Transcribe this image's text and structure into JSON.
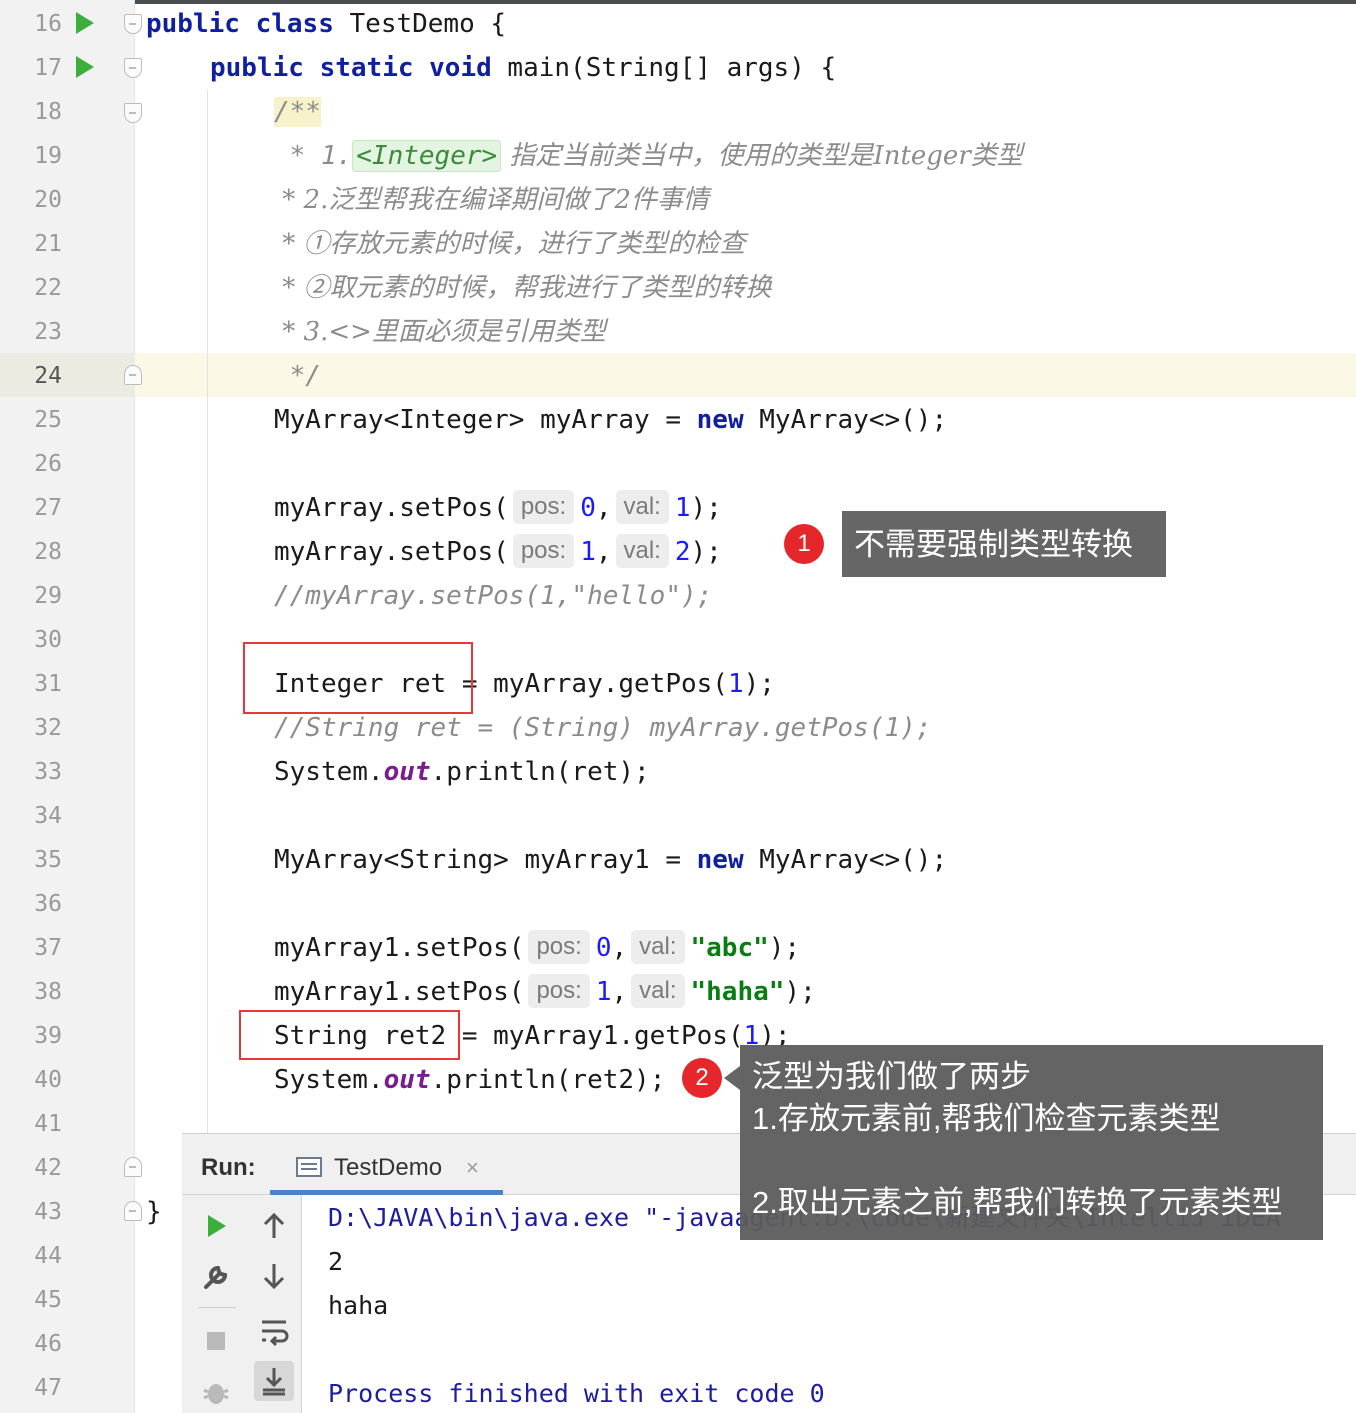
{
  "editor": {
    "line_numbers": [
      "16",
      "17",
      "18",
      "19",
      "20",
      "21",
      "22",
      "23",
      "24",
      "25",
      "26",
      "27",
      "28",
      "29",
      "30",
      "31",
      "32",
      "33",
      "34",
      "35",
      "36",
      "37",
      "38",
      "39",
      "40",
      "41",
      "42",
      "43",
      "44",
      "45",
      "46",
      "47"
    ],
    "current_line": "24",
    "lines": {
      "l16": {
        "kw1": "public",
        "kw2": "class",
        "rest": " TestDemo {"
      },
      "l17": {
        "kw1": "public",
        "kw2": "static",
        "kw3": "void",
        "rest": " main(String[] args) {"
      },
      "l18": {
        "text": "/**"
      },
      "l19": {
        "prefix": " * 1.",
        "tag": "<Integer>",
        "text": " 指定当前类当中，使用的类型是Integer类型"
      },
      "l20": {
        "text": " * 2.泛型帮我在编译期间做了2件事情"
      },
      "l21": {
        "text": " * ①存放元素的时候，进行了类型的检查"
      },
      "l22": {
        "text": " * ②取元素的时候，帮我进行了类型的转换"
      },
      "l23": {
        "text": " * 3.<>里面必须是引用类型"
      },
      "l24": {
        "text": " */"
      },
      "l25": {
        "a": "MyArray<Integer> myArray = ",
        "kw": "new",
        "b": " MyArray<>();"
      },
      "l27": {
        "a": "myArray.setPos(",
        "h1": "pos:",
        "v1": "0",
        "sep": ",",
        "h2": "val:",
        "v2": "1",
        "end": ");"
      },
      "l28": {
        "a": "myArray.setPos(",
        "h1": "pos:",
        "v1": "1",
        "sep": ",",
        "h2": "val:",
        "v2": "2",
        "end": ");"
      },
      "l29": {
        "text": "//myArray.setPos(1,\"hello\");"
      },
      "l31": {
        "a": "Integer ret = myArray.getPos(",
        "v": "1",
        "end": ");"
      },
      "l32": {
        "text": "//String ret = (String) myArray.getPos(1);"
      },
      "l33": {
        "a": "System.",
        "s": "out",
        "b": ".println(ret);"
      },
      "l35": {
        "a": "MyArray<String> myArray1 = ",
        "kw": "new",
        "b": " MyArray<>();"
      },
      "l37": {
        "a": "myArray1.setPos(",
        "h1": "pos:",
        "v1": "0",
        "sep": ",",
        "h2": "val:",
        "str": "\"abc\"",
        "end": ");"
      },
      "l38": {
        "a": "myArray1.setPos(",
        "h1": "pos:",
        "v1": "1",
        "sep": ",",
        "h2": "val:",
        "str": "\"haha\"",
        "end": ");"
      },
      "l39": {
        "a": "String ret2 = myArray1.getPos(",
        "v": "1",
        "end": ");"
      },
      "l40": {
        "a": "System.",
        "s": "out",
        "b": ".println(ret2);"
      },
      "l43": {
        "text": "}"
      }
    }
  },
  "annotations": {
    "callout1": {
      "badge": "1",
      "text": "不需要强制类型转换"
    },
    "callout2": {
      "badge": "2",
      "line1": "泛型为我们做了两步",
      "line2": "1.存放元素前,帮我们检查元素类型",
      "line3": "2.取出元素之前,帮我们转换了元素类型"
    }
  },
  "run_panel": {
    "label": "Run:",
    "tab": "TestDemo",
    "tab_close": "×",
    "console": [
      "D:\\JAVA\\bin\\java.exe \"-javaagent:D:\\code\\新建文件夹\\IntelliJ IDEA",
      "2",
      "haha",
      "",
      "Process finished with exit code 0"
    ],
    "tool_icons": [
      "run-icon",
      "up-arrow-icon",
      "wrench-icon",
      "down-arrow-icon",
      "stop-icon",
      "soft-wrap-icon",
      "debug-icon",
      "scroll-to-end-icon"
    ]
  },
  "colors": {
    "keyword": "#0f1fa0",
    "number": "#1a1aff",
    "string": "#087d10",
    "static_field": "#7a1b8f",
    "comment": "#8c8c8c",
    "badge": "#e5262b",
    "callout_bg": "#666666",
    "red_box": "#e03a3a"
  }
}
